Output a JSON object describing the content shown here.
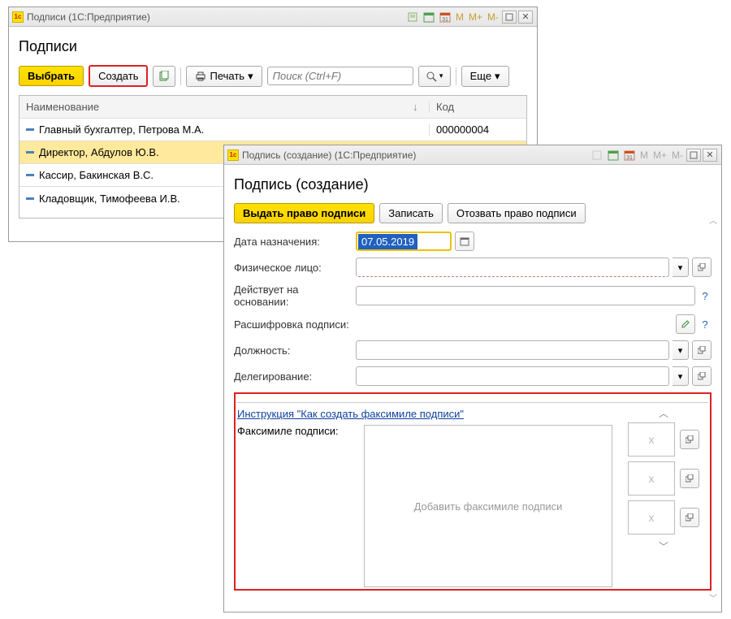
{
  "window1": {
    "titlebar": "Подписи  (1С:Предприятие)",
    "heading": "Подписи",
    "toolbar": {
      "select_label": "Выбрать",
      "create_label": "Создать",
      "print_label": "Печать",
      "more_label": "Еще"
    },
    "search": {
      "placeholder": "Поиск (Ctrl+F)"
    },
    "table": {
      "col_name": "Наименование",
      "col_code": "Код",
      "rows": [
        {
          "name": "Главный бухгалтер, Петрова М.А.",
          "code": "000000004",
          "selected": false
        },
        {
          "name": "Директор, Абдулов Ю.В.",
          "code": "",
          "selected": true
        },
        {
          "name": "Кассир, Бакинская В.С.",
          "code": "",
          "selected": false
        },
        {
          "name": "Кладовщик, Тимофеева И.В.",
          "code": "",
          "selected": false
        }
      ]
    }
  },
  "window2": {
    "titlebar": "Подпись (создание)  (1С:Предприятие)",
    "heading": "Подпись (создание)",
    "toolbar": {
      "issue_label": "Выдать право подписи",
      "save_label": "Записать",
      "revoke_label": "Отозвать право подписи"
    },
    "fields": {
      "date_label": "Дата назначения:",
      "date_value": "07.05.2019",
      "person_label": "Физическое лицо:",
      "basis_label": "Действует на основании:",
      "decoding_label": "Расшифровка подписи:",
      "position_label": "Должность:",
      "delegation_label": "Делегирование:"
    },
    "instruction_link": "Инструкция \"Как создать факсимиле подписи\"",
    "facsimile_label": "Факсимиле подписи:",
    "facsimile_placeholder": "Добавить факсимиле подписи",
    "thumb_x": "x"
  }
}
